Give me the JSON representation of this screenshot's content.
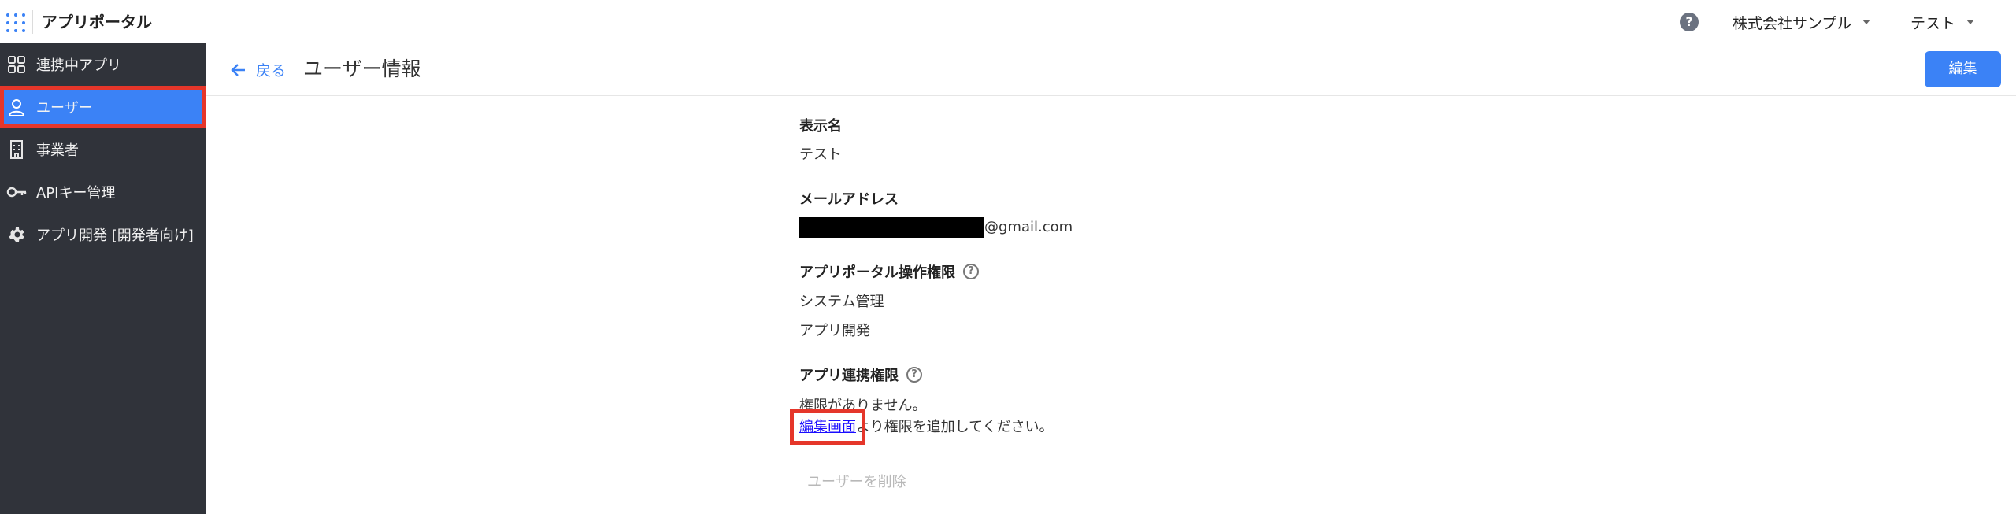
{
  "header": {
    "app_title": "アプリポータル",
    "company": "株式会社サンプル",
    "user": "テスト"
  },
  "sidebar": {
    "items": [
      {
        "label": "連携中アプリ",
        "icon": "apps-grid-icon"
      },
      {
        "label": "ユーザー",
        "icon": "user-icon"
      },
      {
        "label": "事業者",
        "icon": "building-icon"
      },
      {
        "label": "APIキー管理",
        "icon": "key-icon"
      },
      {
        "label": "アプリ開発 [開発者向け]",
        "icon": "gear-icon"
      }
    ]
  },
  "page": {
    "back_label": "戻る",
    "title": "ユーザー情報",
    "edit_label": "編集"
  },
  "details": {
    "display_name_label": "表示名",
    "display_name_value": "テスト",
    "email_label": "メールアドレス",
    "email_suffix": "@gmail.com",
    "portal_perm_label": "アプリポータル操作権限",
    "portal_perms": [
      "システム管理",
      "アプリ開発"
    ],
    "app_perm_label": "アプリ連携権限",
    "no_perm_text": "権限がありません。",
    "edit_screen_link": "編集画面",
    "add_perm_suffix": "より権限を追加してください。",
    "delete_user_label": "ユーザーを削除"
  },
  "colors": {
    "accent": "#3b82f6",
    "sidebar_bg": "#30333a",
    "highlight": "#e5362a"
  }
}
